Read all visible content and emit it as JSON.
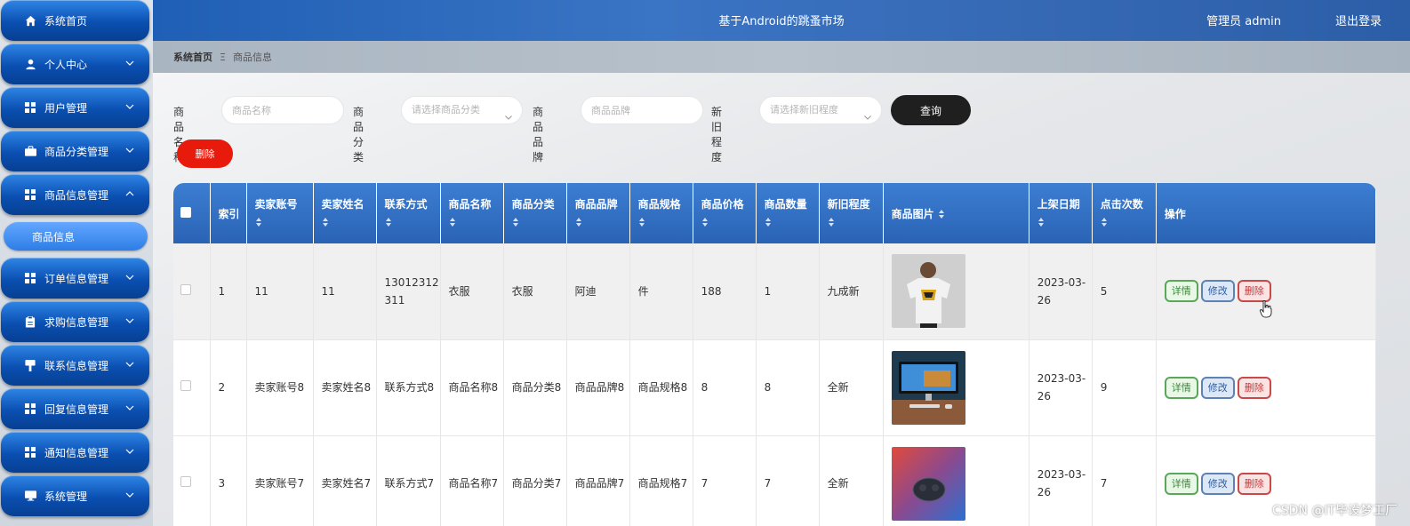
{
  "header": {
    "title": "基于Android的跳蚤市场",
    "user": "管理员 admin",
    "logout": "退出登录"
  },
  "sidebar": {
    "items": [
      {
        "label": "系统首页",
        "icon": "home-icon"
      },
      {
        "label": "个人中心",
        "icon": "person-icon"
      },
      {
        "label": "用户管理",
        "icon": "grid-icon"
      },
      {
        "label": "商品分类管理",
        "icon": "briefcase-icon"
      },
      {
        "label": "商品信息管理",
        "icon": "grid-icon"
      },
      {
        "label": "订单信息管理",
        "icon": "grid-icon"
      },
      {
        "label": "求购信息管理",
        "icon": "clipboard-icon"
      },
      {
        "label": "联系信息管理",
        "icon": "pin-icon"
      },
      {
        "label": "回复信息管理",
        "icon": "grid-icon"
      },
      {
        "label": "通知信息管理",
        "icon": "grid-icon"
      },
      {
        "label": "系统管理",
        "icon": "monitor-icon"
      }
    ],
    "sub_active": "商品信息"
  },
  "breadcrumb": {
    "home": "系统首页",
    "current": "商品信息"
  },
  "search": {
    "name_label": "商品名称",
    "name_placeholder": "商品名称",
    "category_label": "商品分类",
    "category_placeholder": "请选择商品分类",
    "brand_label": "商品品牌",
    "brand_placeholder": "商品品牌",
    "condition_label": "新旧程度",
    "condition_placeholder": "请选择新旧程度",
    "query_button": "查询"
  },
  "batch_delete_label": "删除",
  "table": {
    "headers": [
      "索引",
      "卖家账号",
      "卖家姓名",
      "联系方式",
      "商品名称",
      "商品分类",
      "商品品牌",
      "商品规格",
      "商品价格",
      "商品数量",
      "新旧程度",
      "商品图片",
      "上架日期",
      "点击次数",
      "操作"
    ],
    "rows": [
      {
        "index": "1",
        "seller_account": "11",
        "seller_name": "11",
        "contact": "13012312311",
        "name": "衣服",
        "category": "衣服",
        "brand": "阿迪",
        "spec": "件",
        "price": "188",
        "qty": "1",
        "condition": "九成新",
        "image": "t-shirt-photo",
        "date": "2023-03-26",
        "clicks": "5"
      },
      {
        "index": "2",
        "seller_account": "卖家账号8",
        "seller_name": "卖家姓名8",
        "contact": "联系方式8",
        "name": "商品名称8",
        "category": "商品分类8",
        "brand": "商品品牌8",
        "spec": "商品规格8",
        "price": "8",
        "qty": "8",
        "condition": "全新",
        "image": "monitor-desk-photo",
        "date": "2023-03-26",
        "clicks": "9"
      },
      {
        "index": "3",
        "seller_account": "卖家账号7",
        "seller_name": "卖家姓名7",
        "contact": "联系方式7",
        "name": "商品名称7",
        "category": "商品分类7",
        "brand": "商品品牌7",
        "spec": "商品规格7",
        "price": "7",
        "qty": "7",
        "condition": "全新",
        "image": "earbuds-photo",
        "date": "2023-03-26",
        "clicks": "7"
      }
    ],
    "actions": {
      "detail": "详情",
      "edit": "修改",
      "delete": "删除"
    }
  },
  "watermark": "CSDN @IT毕设梦工厂",
  "colors": {
    "sidebar_button": "#0a4fb1",
    "header": "#2c62b0",
    "query_button": "#1f1f1f",
    "delete_button": "#e81a0c"
  }
}
